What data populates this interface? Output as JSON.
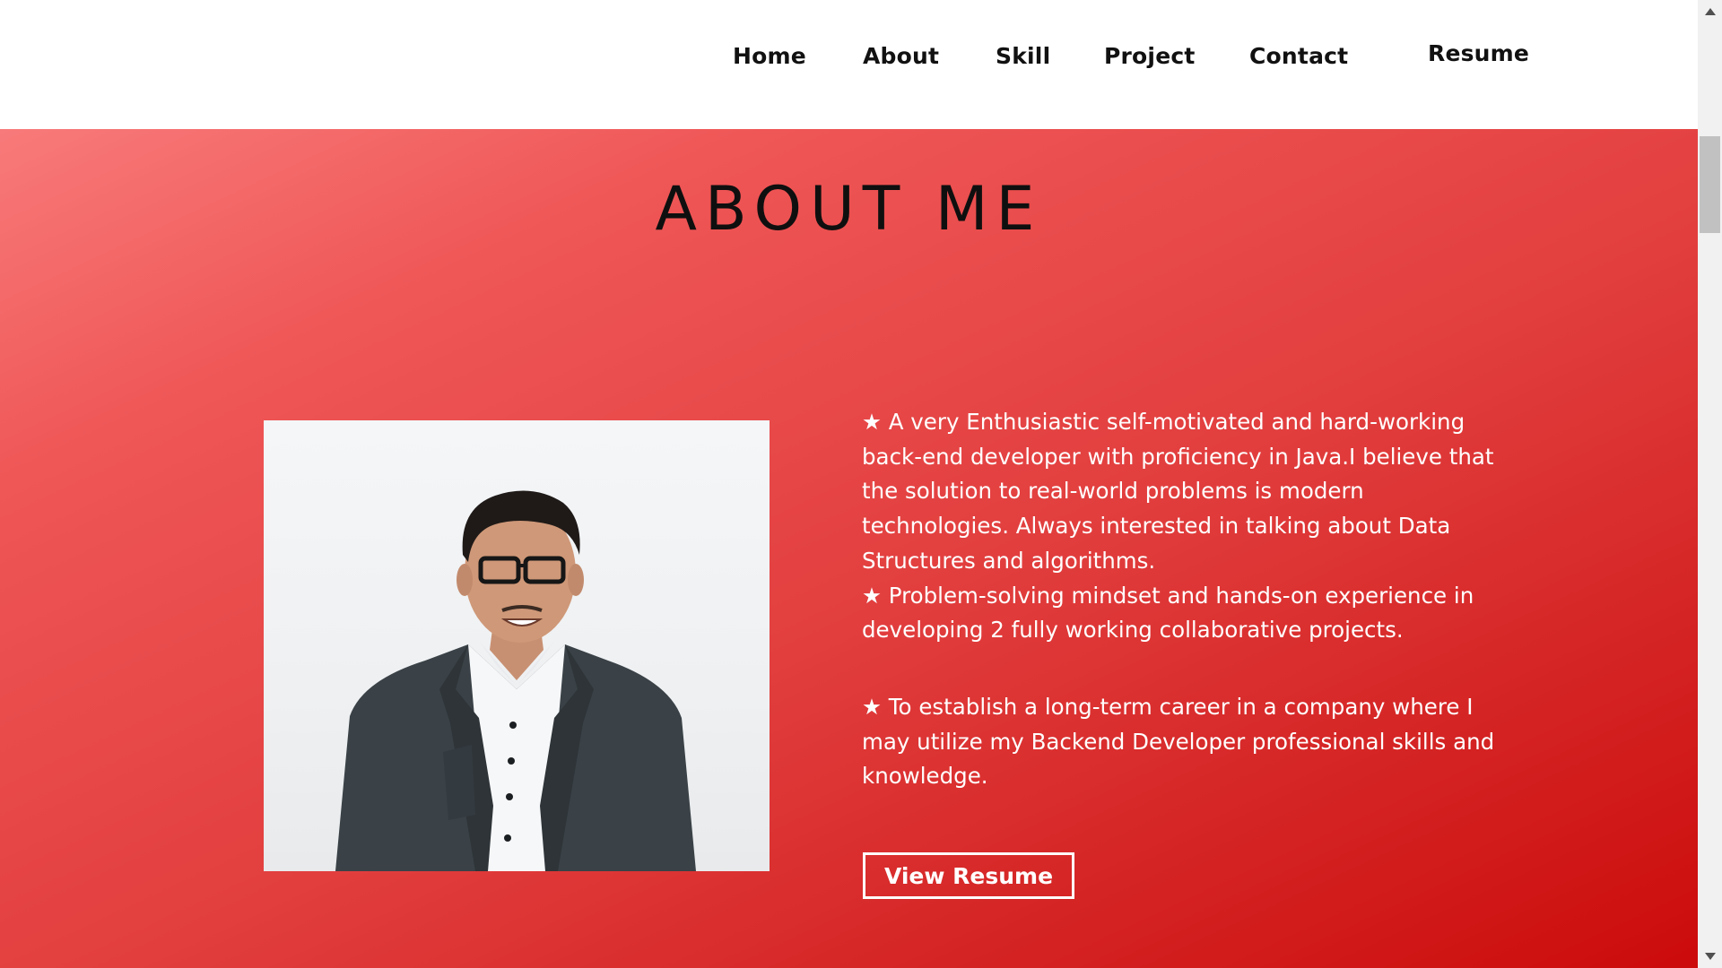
{
  "nav": {
    "home": "Home",
    "about": "About",
    "skill": "Skill",
    "project": "Project",
    "contact": "Contact",
    "resume": "Resume"
  },
  "about": {
    "title": "ABOUT ME",
    "paragraph1": "★ A very Enthusiastic self-motivated and hard-working back-end developer with proficiency in Java.I believe that the solution to real-world problems is modern technologies. Always interested in talking about Data Structures and algorithms.",
    "paragraph2": "★ Problem-solving mindset and hands-on experience in developing 2 fully working collaborative projects.",
    "paragraph3": "★ To establish a long-term career in a company where I may utilize my Backend Developer professional skills and knowledge.",
    "button_label": "View Resume",
    "photo_icon": "profile-photo"
  },
  "colors": {
    "gradient_start": "#f87a7a",
    "gradient_end": "#cc0b0b",
    "text_on_red": "#ffffff",
    "nav_text": "#111111"
  }
}
